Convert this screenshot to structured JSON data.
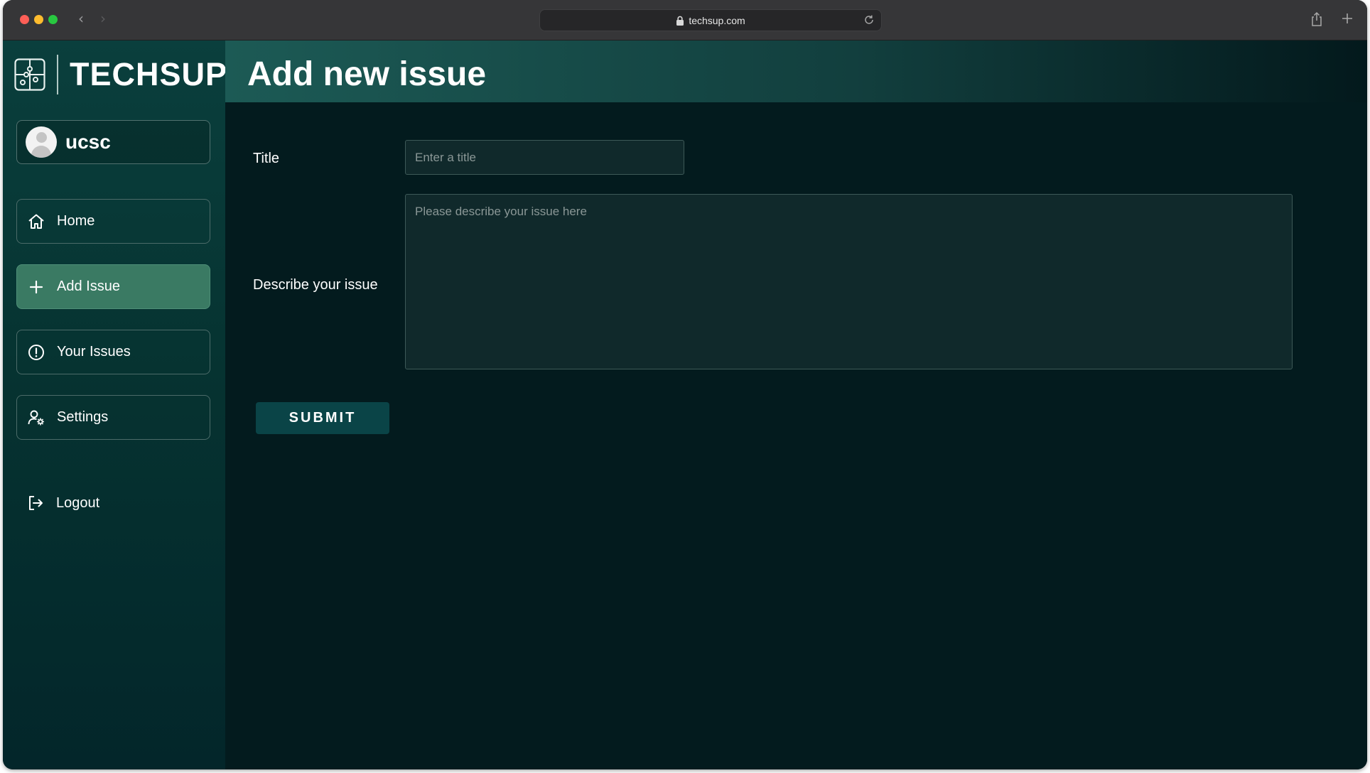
{
  "browser": {
    "url": "techsup.com"
  },
  "brand": {
    "name": "TECHSUP"
  },
  "user": {
    "name": "ucsc"
  },
  "sidebar": {
    "items": [
      {
        "label": "Home",
        "icon": "home-icon"
      },
      {
        "label": "Add Issue",
        "icon": "plus-icon",
        "active": true
      },
      {
        "label": "Your Issues",
        "icon": "exclamation-circle-icon"
      },
      {
        "label": "Settings",
        "icon": "user-gear-icon"
      }
    ],
    "logout_label": "Logout"
  },
  "main": {
    "title": "Add new issue",
    "form": {
      "title_label": "Title",
      "title_placeholder": "Enter a title",
      "title_value": "",
      "desc_label": "Describe your issue",
      "desc_placeholder": "Please describe your issue here",
      "desc_value": "",
      "submit_label": "SUBMIT"
    }
  },
  "colors": {
    "accent_active": "#3a7a63",
    "background": "#031b1e",
    "submit": "#0a4447"
  }
}
